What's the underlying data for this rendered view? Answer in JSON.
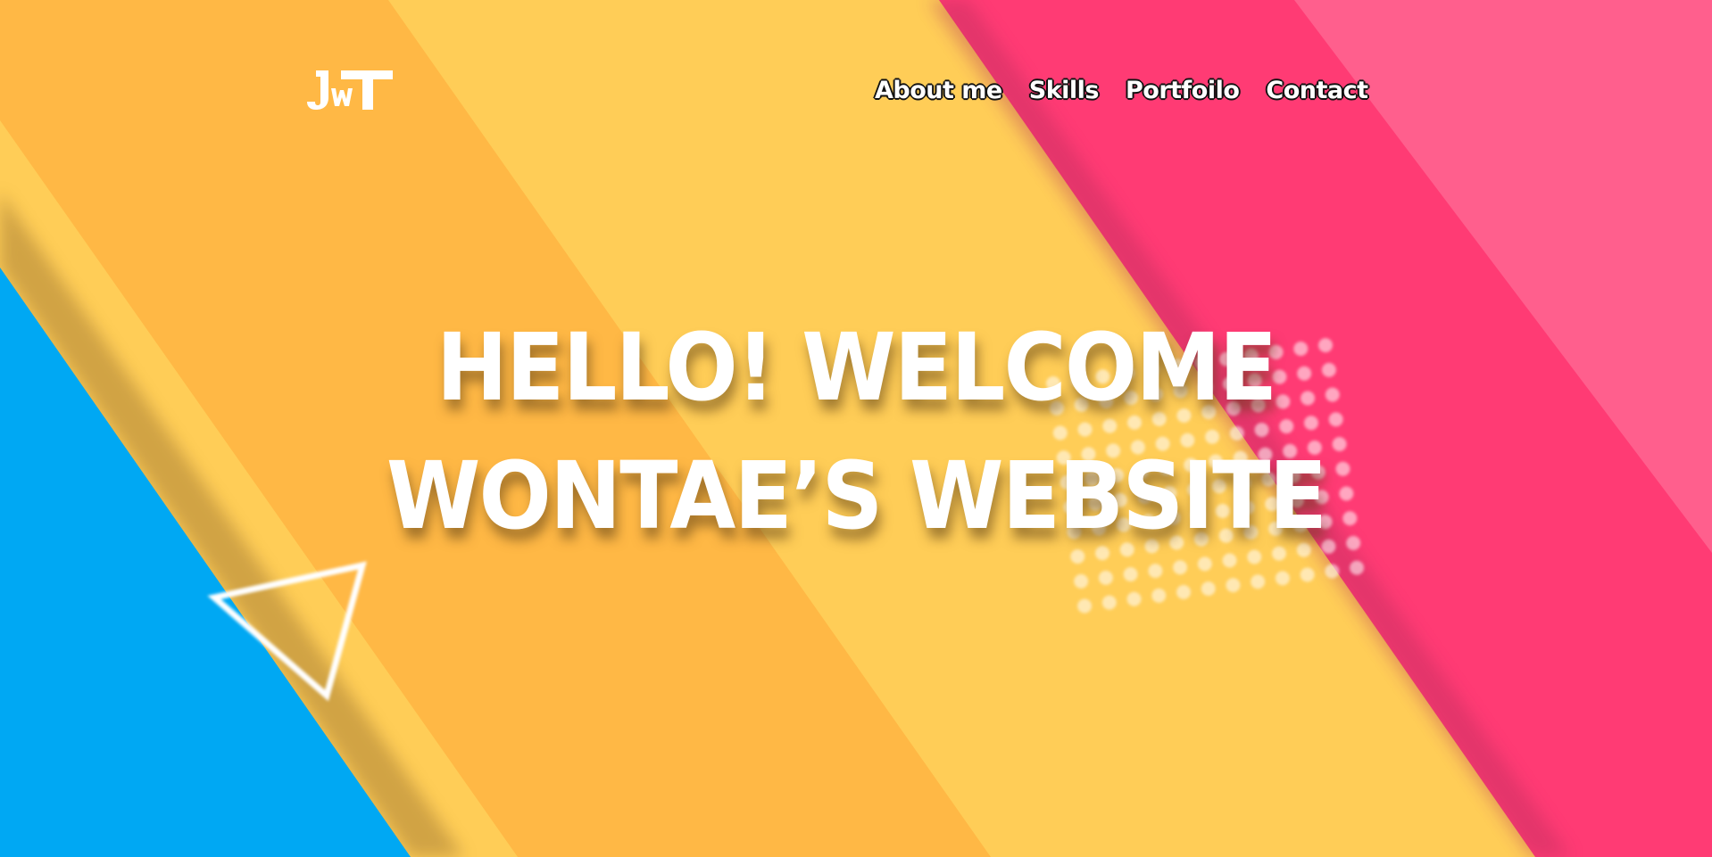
{
  "logo": {
    "text": "JWT",
    "icon": "jwt-logo-icon"
  },
  "nav": {
    "items": [
      {
        "label": "About me"
      },
      {
        "label": "Skills"
      },
      {
        "label": "Portfoilo"
      },
      {
        "label": "Contact"
      }
    ]
  },
  "hero": {
    "line1": "HELLO! WELCOME",
    "line2": "WONTAE’S WEBSITE"
  },
  "colors": {
    "blue": "#00a8f3",
    "orange": "#ffb845",
    "yellow": "#ffcd57",
    "pink": "#ff3b74",
    "light_pink": "#ff5f8d",
    "text": "#ffffff"
  },
  "decorations": {
    "triangle": "triangle-outline-icon",
    "dot_grid": "dot-grid-pattern"
  }
}
